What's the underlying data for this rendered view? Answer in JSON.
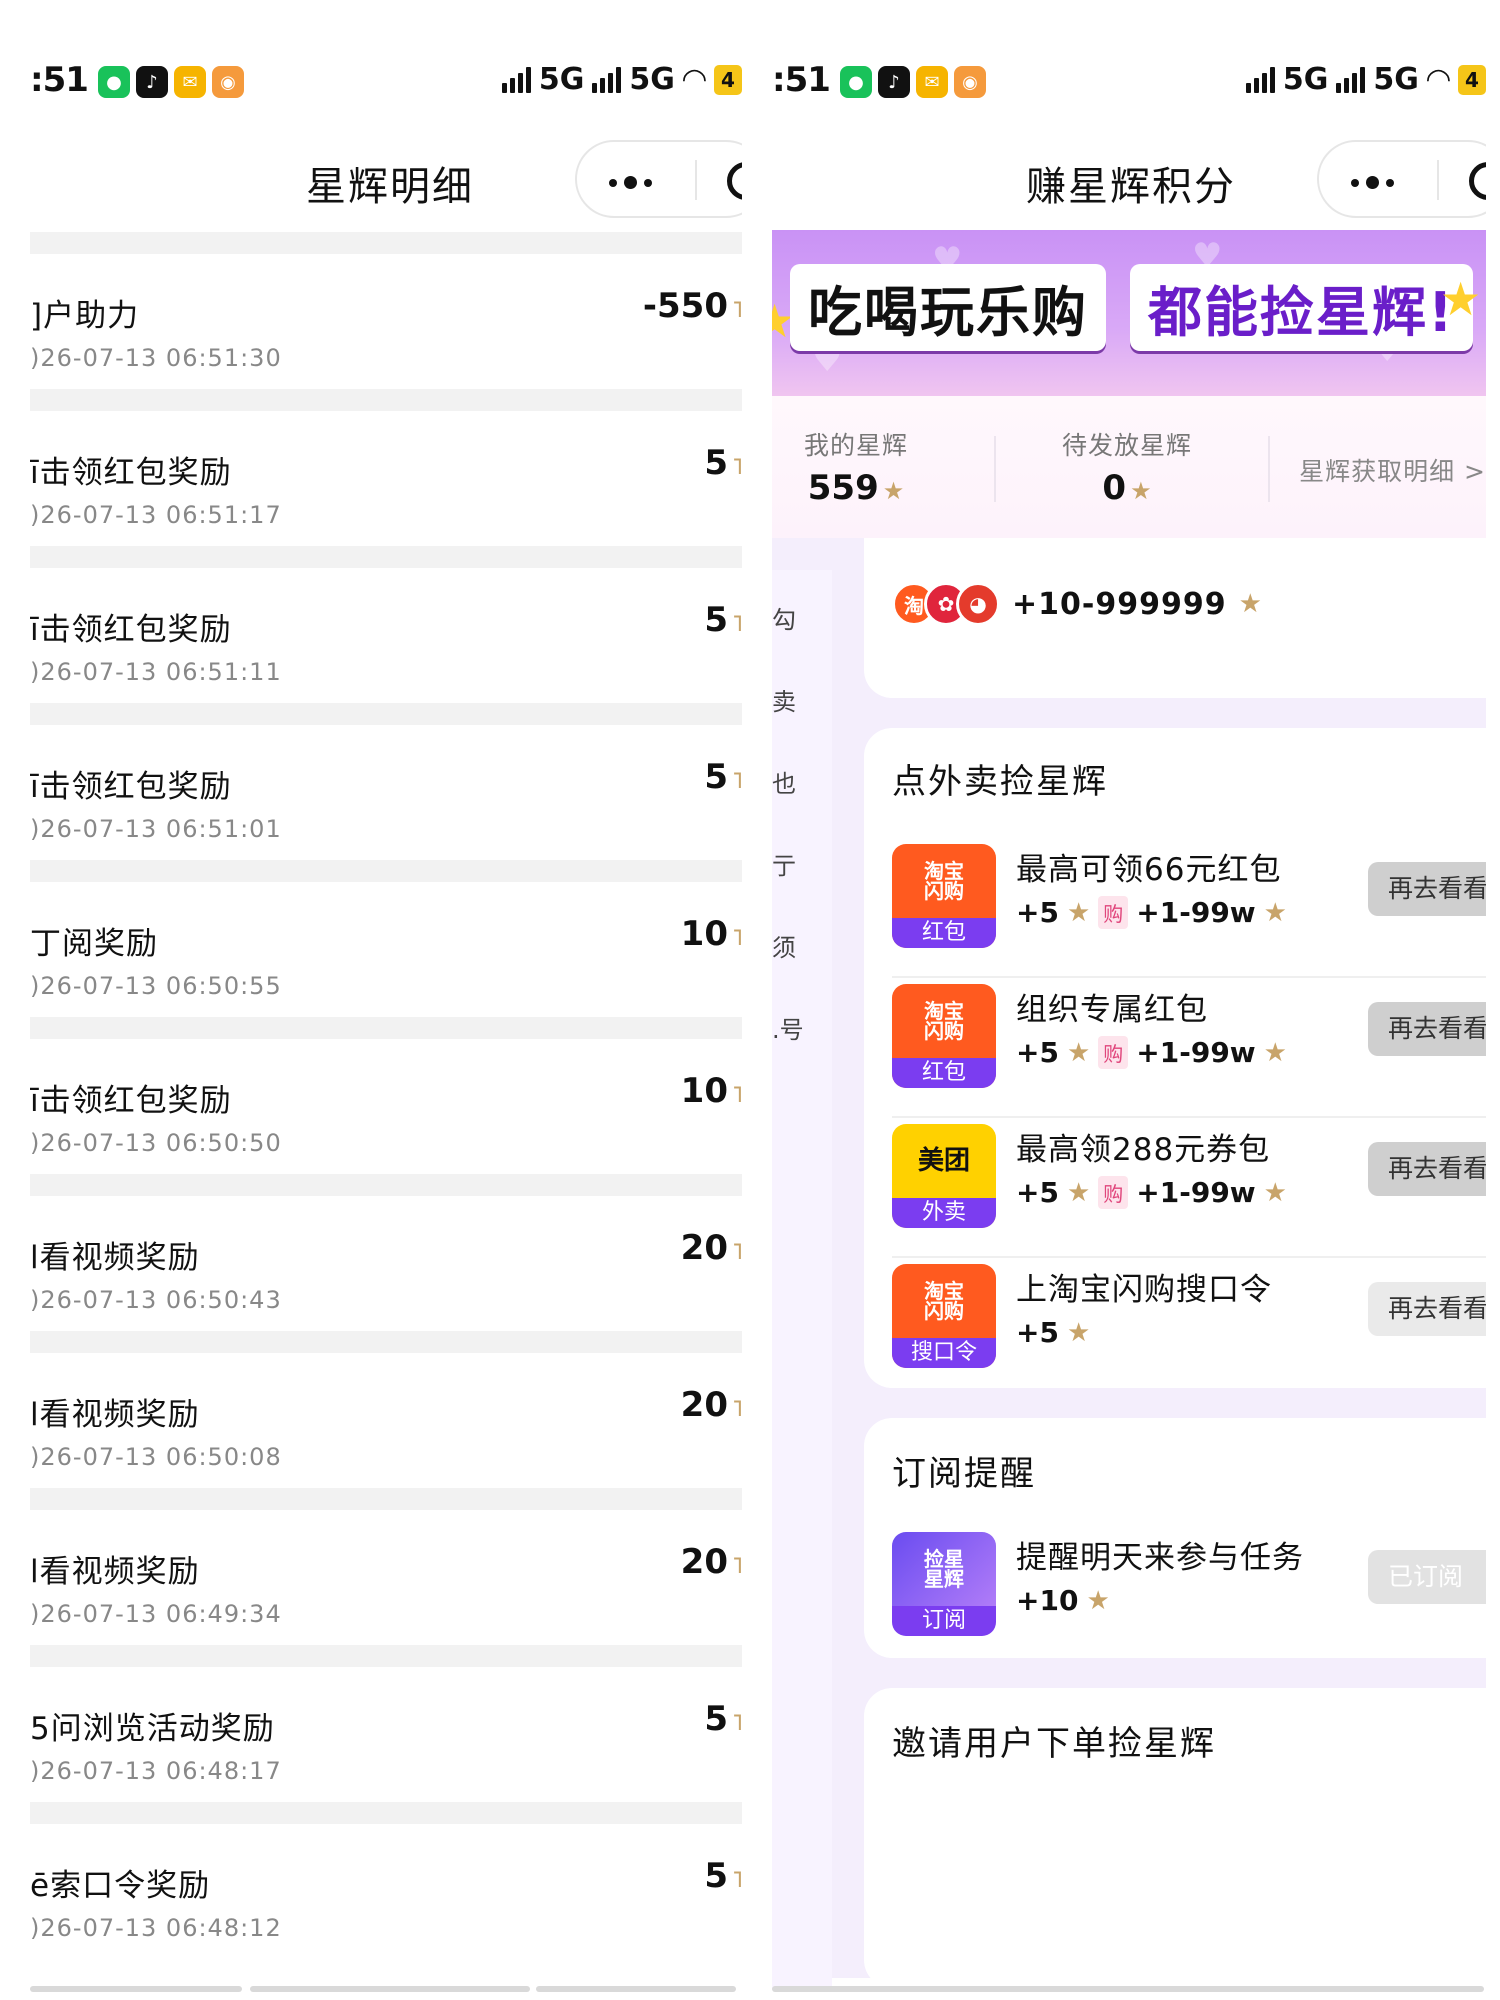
{
  "status": {
    "time": ":51",
    "network1": "5G",
    "network2": "5G",
    "battery": "4"
  },
  "left": {
    "title": "星辉明细",
    "records": [
      {
        "name": "]户助力",
        "time": ")26-07-13 06:51:30",
        "amount": "-550"
      },
      {
        "name": "ī击领红包奖励",
        "time": ")26-07-13 06:51:17",
        "amount": "5"
      },
      {
        "name": "ī击领红包奖励",
        "time": ")26-07-13 06:51:11",
        "amount": "5"
      },
      {
        "name": "ī击领红包奖励",
        "time": ")26-07-13 06:51:01",
        "amount": "5"
      },
      {
        "name": "丁阅奖励",
        "time": ")26-07-13 06:50:55",
        "amount": "10"
      },
      {
        "name": "ī击领红包奖励",
        "time": ")26-07-13 06:50:50",
        "amount": "10"
      },
      {
        "name": "l看视频奖励",
        "time": ")26-07-13 06:50:43",
        "amount": "20"
      },
      {
        "name": "l看视频奖励",
        "time": ")26-07-13 06:50:08",
        "amount": "20"
      },
      {
        "name": "l看视频奖励",
        "time": ")26-07-13 06:49:34",
        "amount": "20"
      },
      {
        "name": "5问浏览活动奖励",
        "time": ")26-07-13 06:48:17",
        "amount": "5"
      },
      {
        "name": "ē索口令奖励",
        "time": ")26-07-13 06:48:12",
        "amount": "5"
      }
    ]
  },
  "right": {
    "title": "赚星辉积分",
    "banner": {
      "part1": "吃喝玩乐购",
      "part2": "都能捡星辉!"
    },
    "stats": {
      "my_label": "我的星辉",
      "my_value": "559",
      "pending_label": "待发放星辉",
      "pending_value": "0",
      "detail_link": "星辉获取明细 >"
    },
    "sidenav": [
      "勾",
      "卖",
      "也",
      "亍",
      "须",
      ".号"
    ],
    "brand_range": "+10-999999",
    "section1_title": "点外卖捡星辉",
    "tasks": [
      {
        "logo_top": "淘宝\n闪购",
        "logo_sub": "红包",
        "name": "最高可领66元红包",
        "reward": "+5",
        "gou": "购",
        "gou_reward": "+1-99w",
        "button": "再去看看"
      },
      {
        "logo_top": "淘宝\n闪购",
        "logo_sub": "红包",
        "name": "组织专属红包",
        "reward": "+5",
        "gou": "购",
        "gou_reward": "+1-99w",
        "button": "再去看看"
      },
      {
        "logo_top": "美团",
        "logo_sub": "外卖",
        "name": "最高领288元券包",
        "reward": "+5",
        "gou": "购",
        "gou_reward": "+1-99w",
        "button": "再去看看"
      },
      {
        "logo_top": "淘宝\n闪购",
        "logo_sub": "搜口令",
        "name": "上淘宝闪购搜口令",
        "reward": "+5",
        "button": "再去看看"
      }
    ],
    "section2_title": "订阅提醒",
    "subscribe_task": {
      "logo_top": "捡星\n星辉",
      "logo_sub": "订阅",
      "name": "提醒明天来参与任务",
      "reward": "+10",
      "button": "已订阅"
    },
    "section3_title": "邀请用户下单捡星辉"
  },
  "colors": {
    "accent_purple": "#7b3df0",
    "gold_star": "#c8a46a",
    "taobao_orange": "#ff5a1f",
    "meituan_yellow": "#ffd100"
  }
}
